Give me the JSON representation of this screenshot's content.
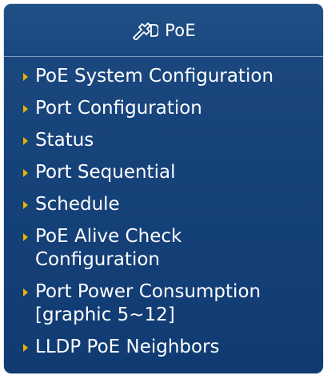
{
  "header": {
    "title": "PoE",
    "icon": "poe-plug-icon"
  },
  "menu": {
    "items": [
      {
        "label_lines": [
          "PoE System Configuration"
        ]
      },
      {
        "label_lines": [
          "Port Configuration"
        ]
      },
      {
        "label_lines": [
          "Status"
        ]
      },
      {
        "label_lines": [
          "Port Sequential"
        ]
      },
      {
        "label_lines": [
          "Schedule"
        ]
      },
      {
        "label_lines": [
          "PoE Alive Check",
          "Configuration"
        ]
      },
      {
        "label_lines": [
          "Port Power Consumption",
          "[graphic 5~12]"
        ]
      },
      {
        "label_lines": [
          "LLDP PoE Neighbors"
        ]
      }
    ]
  },
  "colors": {
    "panel_blue": "#16427a",
    "text": "#ffffff",
    "arrow": "#e8b400"
  }
}
